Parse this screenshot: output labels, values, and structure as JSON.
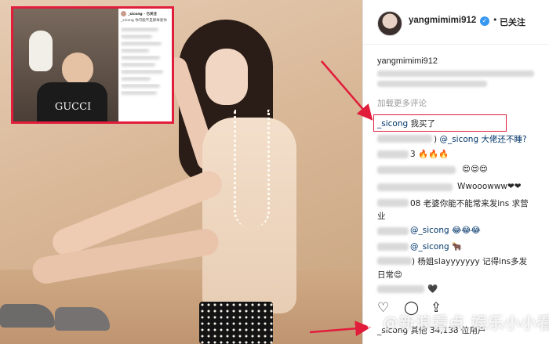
{
  "inset": {
    "brand_text": "GUCCI",
    "header_account": "_sicong · 已关注",
    "header_sub": "",
    "rows": [
      "_sicong 你可能不是那样爱你",
      "",
      "",
      "",
      "",
      "",
      "",
      "",
      "",
      "",
      "",
      "",
      "",
      ""
    ]
  },
  "post": {
    "username": "yangmimimi912",
    "follow_separator": "•",
    "follow_status": "已关注",
    "caption_username": "yangmimimi912",
    "load_more": "加载更多评论"
  },
  "comments": [
    {
      "user": "_sicong",
      "text": "我买了"
    },
    {
      "user": "",
      "text": "@_sicong 大佬还不睡?",
      "prefix": ")"
    },
    {
      "user": "",
      "text": "3 🔥🔥🔥"
    },
    {
      "user": "",
      "text": "😍😍😍"
    },
    {
      "user": "",
      "text": "Wwooowww❤❤"
    },
    {
      "user": "",
      "text": "08 老婆你能不能常来发ins 求营",
      "cont": "业"
    },
    {
      "user": "",
      "text": "@_sicong 😂😂😂"
    },
    {
      "user": "",
      "text": "@_sicong 🐂"
    },
    {
      "user": "",
      "text": ") 杨姐slayyyyyyy 记得ins多发",
      "cont": "日常😍"
    },
    {
      "user": "",
      "text": "🖤"
    }
  ],
  "actions": {
    "like_icon": "heart-outline-icon",
    "comment_icon": "comment-bubble-icon",
    "share_icon": "share-icon"
  },
  "bottom_line": "_sicong 其他 34,138 位用户",
  "watermark": "@新浪看点 娱乐小小看",
  "colors": {
    "highlight_red": "#e11d3b",
    "ig_blue": "#3897f0",
    "mention_blue": "#003569"
  }
}
